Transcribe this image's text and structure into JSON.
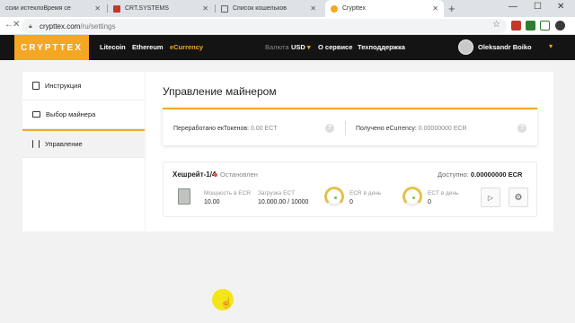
{
  "browser": {
    "tabs": [
      {
        "title": "сcии истеклоВремя се",
        "fav_color": "#5f6368"
      },
      {
        "title": "CRT.SYSTEMS",
        "fav_color": "#c0392b"
      },
      {
        "title": "Список кошельков",
        "fav_color": "#5f6368"
      },
      {
        "title": "Crypttex",
        "fav_color": "#f5a623"
      }
    ],
    "new_tab": "+",
    "url_host": "crypttex.com",
    "url_path": "/ru/settings",
    "win_min": "—",
    "win_max": "☐",
    "win_close": "✕",
    "back": "←",
    "stop": "✕",
    "star": "☆"
  },
  "header": {
    "logo": "CRYPTTEX",
    "nav": [
      "Litecoin",
      "Ethereum",
      "eCurrency"
    ],
    "currency_label": "Валюта",
    "currency_value": "USD",
    "about": "О сервисе",
    "support": "Техподдержка",
    "user": "Oleksandr Boiko",
    "accent": "#f5a623"
  },
  "sidebar": {
    "items": [
      {
        "label": "Инструкция"
      },
      {
        "label": "Выбор майнера"
      },
      {
        "label": "Управление"
      }
    ]
  },
  "main": {
    "title": "Управление майнером",
    "stats": {
      "processed_label": "Переработано екТокенов:",
      "processed_value": "0.00 ECT",
      "received_label": "Получено eCurrency:",
      "received_value": "0.00000000 ECR",
      "help": "?"
    },
    "miner": {
      "name": "Хешрейт-1/4",
      "status": "Остановлен",
      "available_label": "Доступно:",
      "available_value": "0.00000000 ECR",
      "power_label": "Мощность в ECR",
      "power_value": "10.00",
      "load_label": "Загрузка ECT",
      "load_value": "10.000.00 / 10000",
      "ecr_day_label": "ECR в день",
      "ecr_day_value": "0",
      "ect_day_label": "ECT в день",
      "ect_day_value": "0",
      "play": "▷",
      "settings": "⚙"
    }
  }
}
